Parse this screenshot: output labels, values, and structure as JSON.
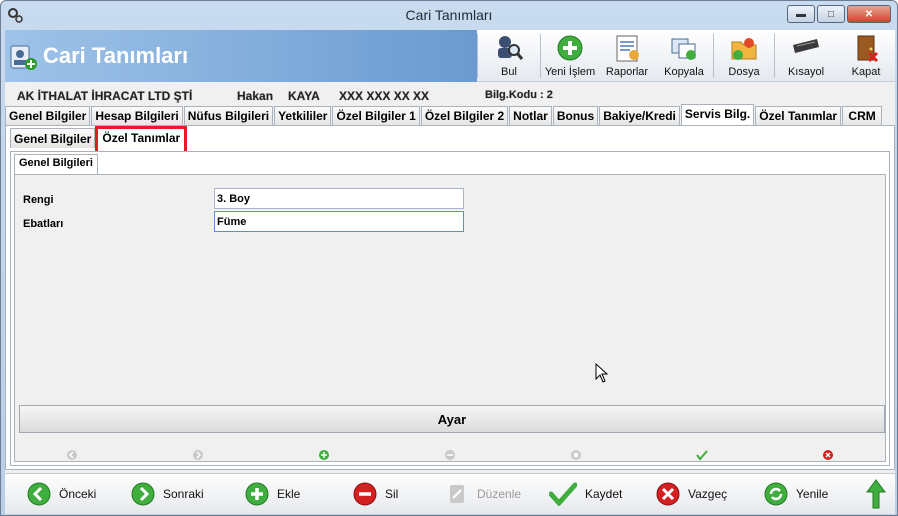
{
  "window": {
    "title": "Cari Tanımları"
  },
  "header": {
    "title": "Cari Tanımları"
  },
  "toolbar": {
    "items": [
      {
        "label": "Bul",
        "icon": "search-person-icon"
      },
      {
        "label": "Yeni İşlem",
        "icon": "green-plus-icon"
      },
      {
        "label": "Raporlar",
        "icon": "report-icon"
      },
      {
        "label": "Kopyala",
        "icon": "copy-icon"
      },
      {
        "label": "Dosya",
        "icon": "folder-icon"
      },
      {
        "label": "Kısayol",
        "icon": "keyboard-icon"
      },
      {
        "label": "Kapat",
        "icon": "exit-door-icon"
      }
    ]
  },
  "record": {
    "company": "AK İTHALAT İHRACAT LTD ŞTİ",
    "first_name": "Hakan",
    "last_name": "KAYA",
    "phone": "XXX XXX XX XX",
    "code_label": "Bilg.Kodu : 2"
  },
  "main_tabs": [
    "Genel Bilgiler",
    "Hesap Bilgileri",
    "Nüfus Bilgileri",
    "Yetkililer",
    "Özel Bilgiler 1",
    "Özel Bilgiler 2",
    "Notlar",
    "Bonus",
    "Bakiye/Kredi",
    "Servis Bilg.",
    "Özel Tanımlar",
    "CRM"
  ],
  "sub_tabs": [
    "Genel Bilgiler",
    "Özel Tanımlar"
  ],
  "inner_tab": "Genel Bilgileri",
  "form": {
    "rengi_label": "Rengi",
    "rengi_value": "3. Boy",
    "ebat_label": "Ebatları",
    "ebat_value": "Füme"
  },
  "ayar_label": "Ayar",
  "bottom": {
    "prev": "Önceki",
    "next": "Sonraki",
    "add": "Ekle",
    "delete": "Sil",
    "edit": "Düzenle",
    "save": "Kaydet",
    "cancel": "Vazgeç",
    "refresh": "Yenile"
  },
  "colors": {
    "highlight": "#e01c24",
    "header_blue": "#6a9ad0",
    "green": "#2e9a2e",
    "red": "#d42020"
  }
}
